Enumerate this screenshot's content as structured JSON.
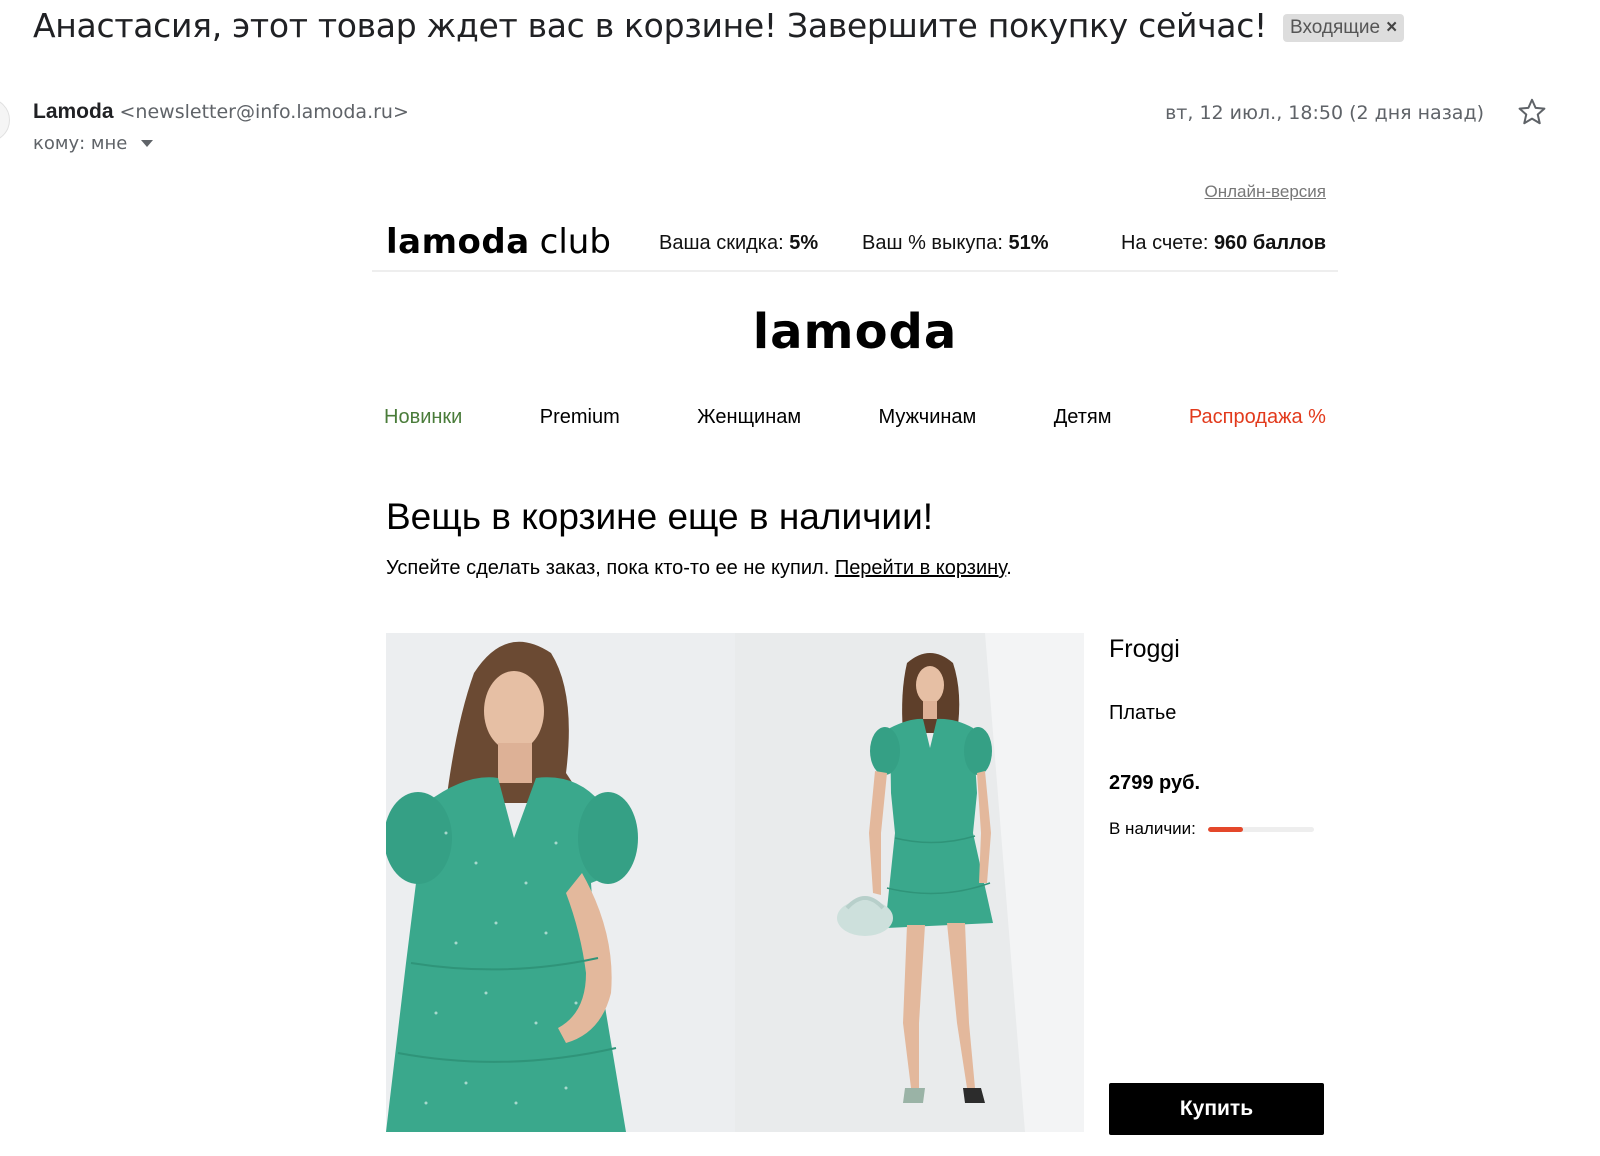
{
  "gmail": {
    "subject": "Анастасия, этот товар ждет вас в корзине! Завершите покупку сейчас!",
    "label": "Входящие",
    "label_close": "×",
    "sender_name": "Lamoda",
    "sender_email": "<newsletter@info.lamoda.ru>",
    "to_text": "кому: мне",
    "date": "вт, 12 июл., 18:50 (2 дня назад)",
    "star_icon": "star-icon"
  },
  "email": {
    "online_version": "Онлайн-версия",
    "club": {
      "logo_brand": "lamoda",
      "logo_suffix": "club",
      "discount_label": "Ваша скидка: ",
      "discount_value": "5%",
      "buyout_label": "Ваш % выкупа: ",
      "buyout_value": "51%",
      "balance_label": "На счете: ",
      "balance_value": "960 баллов"
    },
    "logo": "lamoda",
    "nav": [
      {
        "label": "Новинки",
        "color": "#4a7c3a"
      },
      {
        "label": "Premium"
      },
      {
        "label": "Женщинам"
      },
      {
        "label": "Мужчинам"
      },
      {
        "label": "Детям"
      },
      {
        "label": "Распродажа %",
        "color": "#e23a1c"
      }
    ],
    "headline": "Вещь в корзине еще в наличии!",
    "subline_text": "Успейте сделать заказ, пока кто-то ее не купил. ",
    "subline_link": "Перейти в корзину",
    "subline_end": ".",
    "product": {
      "brand": "Froggi",
      "type": "Платье",
      "price": "2799 руб.",
      "stock_label": "В наличии:",
      "stock_level": 0.33,
      "buy_label": "Купить",
      "dress_color": "#3aa88c"
    }
  }
}
